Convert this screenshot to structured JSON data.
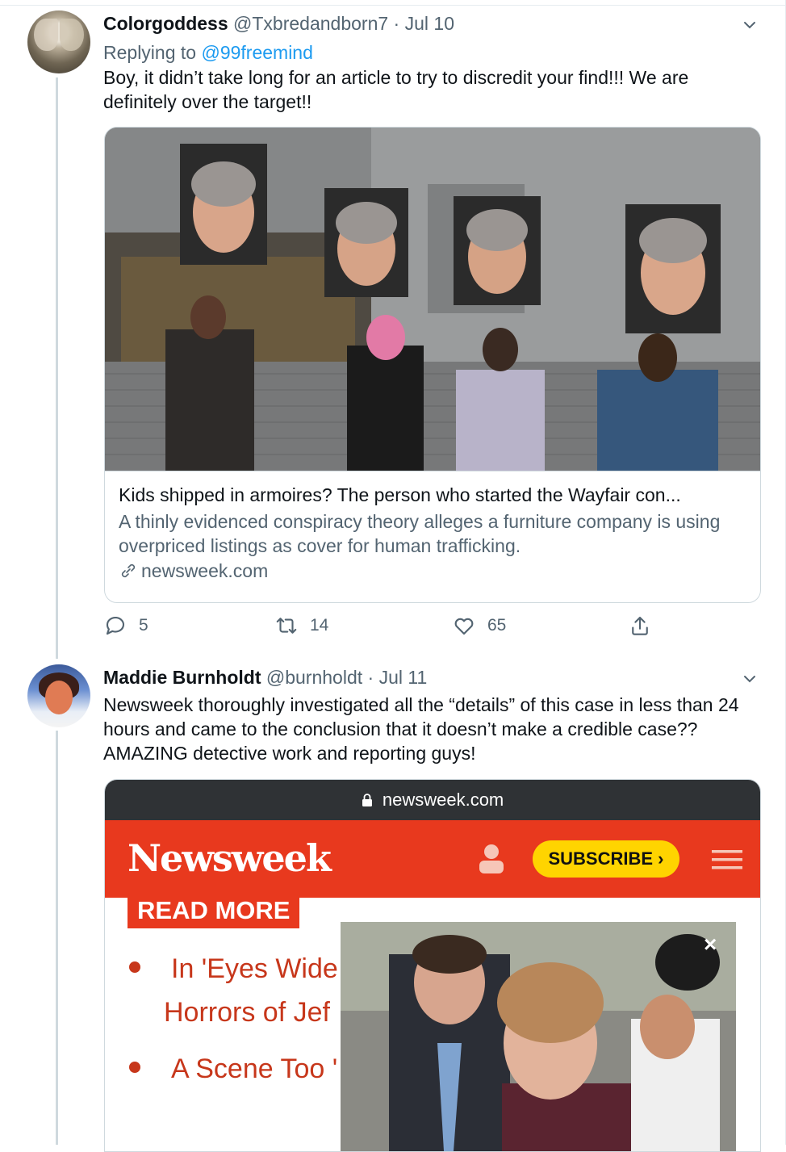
{
  "tweet1": {
    "name": "Colorgoddess",
    "handle": "@Txbredandborn7",
    "separator": "·",
    "date": "Jul 10",
    "replying_prefix": "Replying to",
    "replying_to": "@99freemind",
    "text": "Boy, it didn’t take long for an article to try to discredit your find!!! We are definitely over the target!!",
    "card": {
      "title": "Kids shipped in armoires? The person who started the Wayfair con...",
      "description": "A thinly evidenced conspiracy theory alleges a furniture company is using overpriced listings as cover for human trafficking.",
      "domain": "newsweek.com"
    },
    "actions": {
      "replies": "5",
      "retweets": "14",
      "likes": "65"
    }
  },
  "tweet2": {
    "name": "Maddie Burnholdt",
    "handle": "@burnholdt",
    "separator": "·",
    "date": "Jul 11",
    "text": "Newsweek thoroughly investigated all the “details” of this case in less than 24 hours and came to the conclusion that it doesn’t make a credible case??  AMAZING detective work and reporting guys!",
    "screenshot": {
      "url": "newsweek.com",
      "logo": "Newsweek",
      "subscribe": "SUBSCRIBE ›",
      "read_more": "READ MORE",
      "article1_line1": "In 'Eyes Wide",
      "article1_line2": "Horrors of Jef",
      "article2": "A Scene Too '",
      "close": "×"
    }
  },
  "colors": {
    "accent": "#1d9bf0",
    "newsweek_red": "#e8391e",
    "subscribe_yellow": "#ffd400",
    "muted_text": "#536471"
  },
  "icons": [
    "reply-icon",
    "retweet-icon",
    "like-icon",
    "share-icon",
    "caret-down-icon",
    "link-icon",
    "lock-icon",
    "user-icon",
    "hamburger-menu-icon",
    "close-icon"
  ]
}
